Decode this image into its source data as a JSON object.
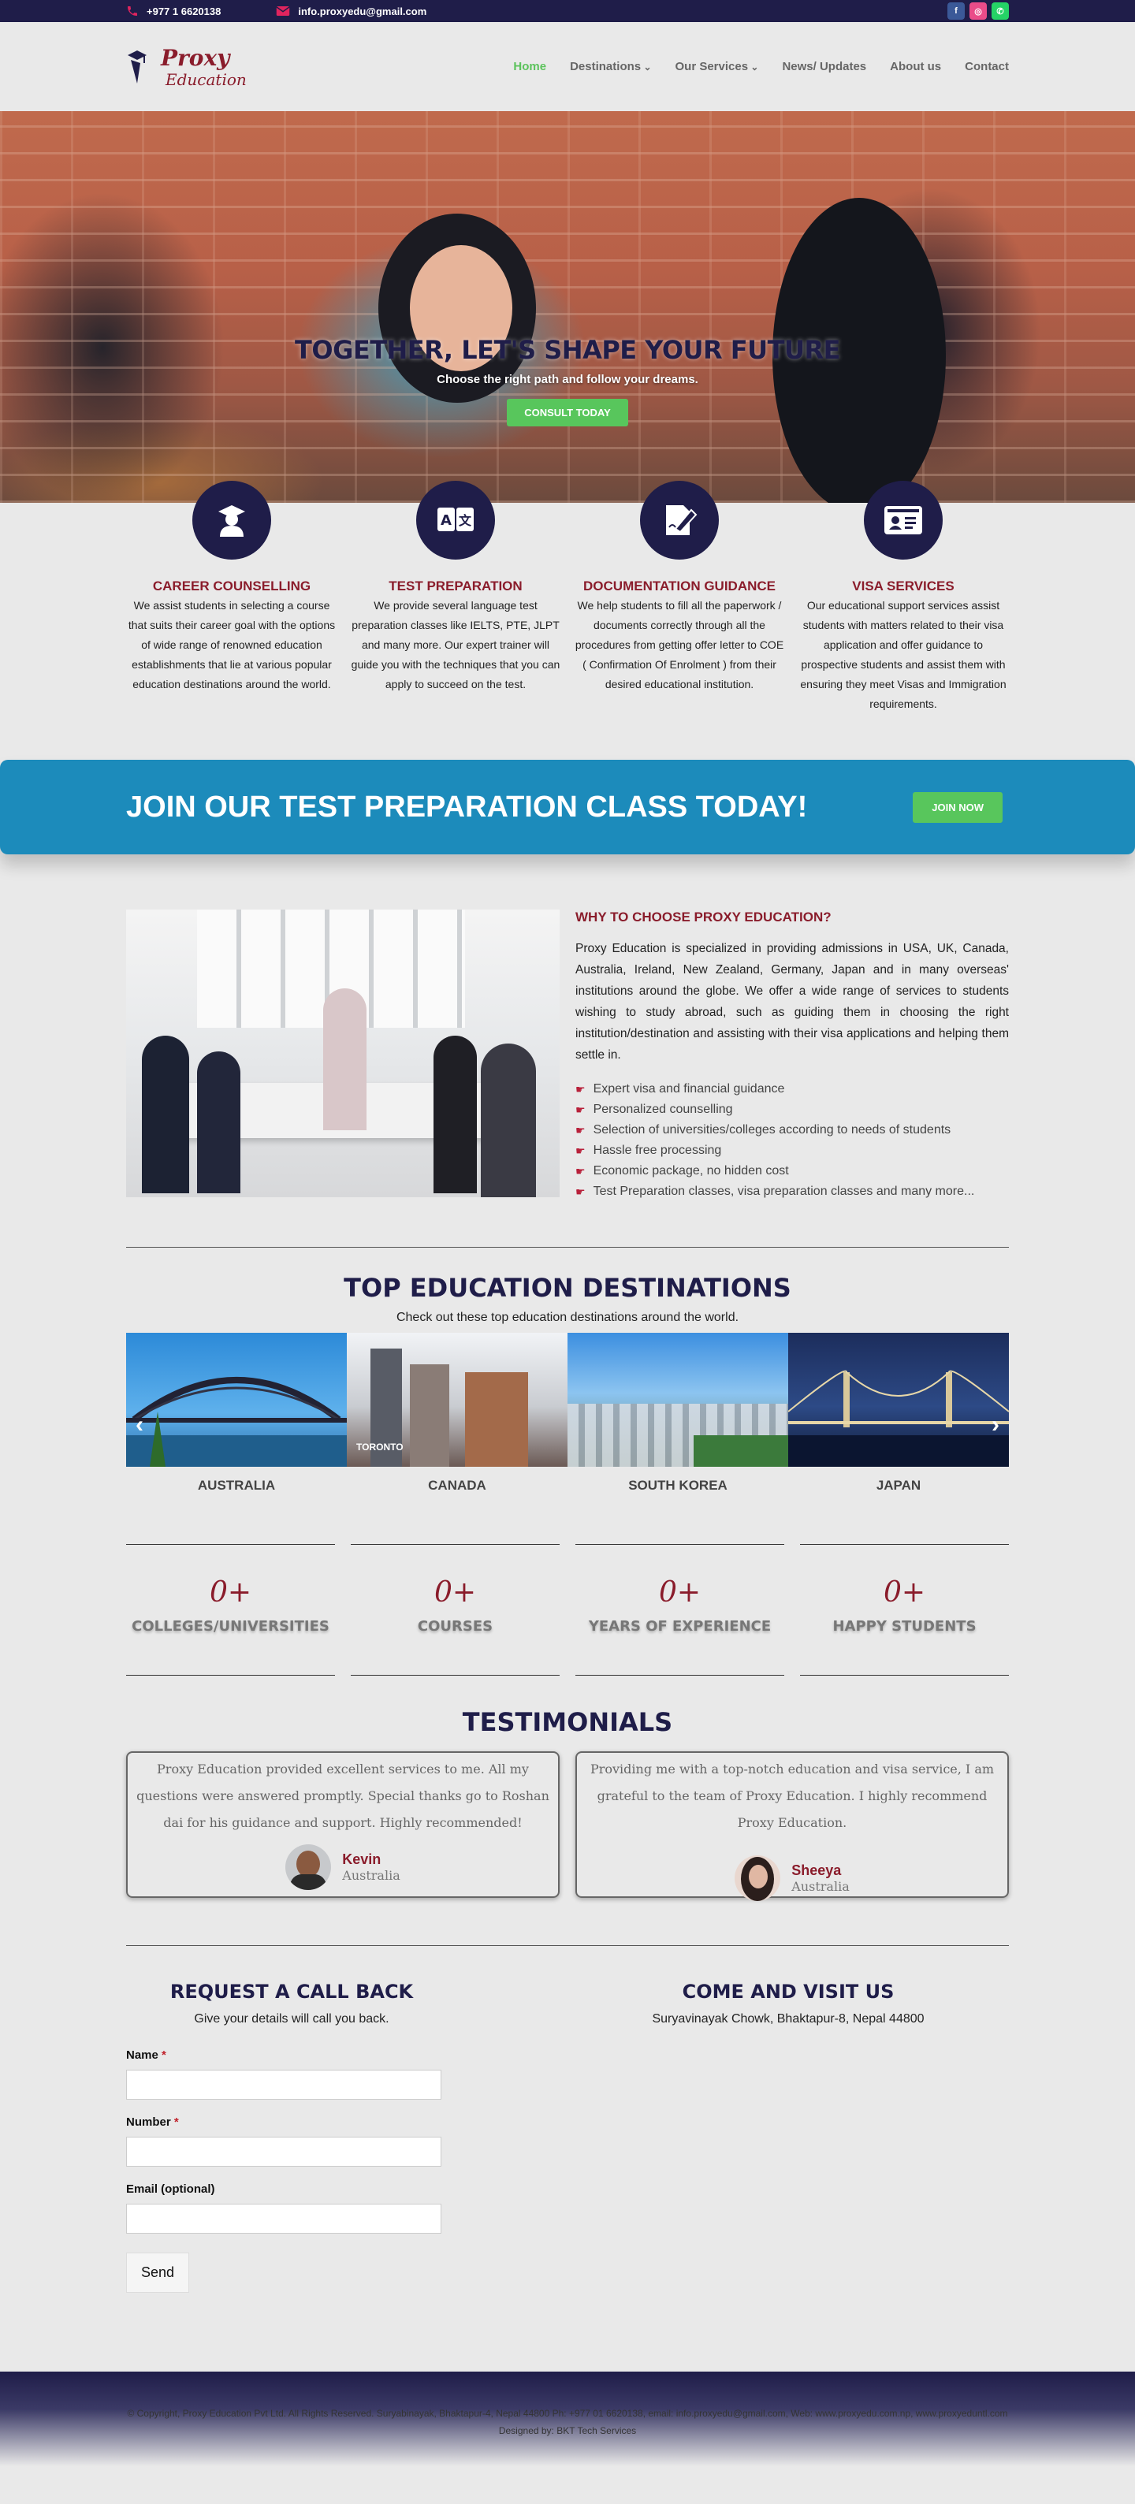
{
  "topbar": {
    "phone": "+977 1 6620138",
    "email": "info.proxyedu@gmail.com",
    "socials": [
      {
        "name": "facebook",
        "color": "#3b5998",
        "glyph": "f"
      },
      {
        "name": "instagram",
        "color": "#ea4c89",
        "glyph": "◎"
      },
      {
        "name": "whatsapp",
        "color": "#25d366",
        "glyph": "✆"
      }
    ]
  },
  "header": {
    "logo_line1": "Proxy",
    "logo_line2": "Education",
    "nav": [
      {
        "label": "Home",
        "active": true
      },
      {
        "label": "Destinations",
        "dropdown": true
      },
      {
        "label": "Our Services",
        "dropdown": true
      },
      {
        "label": "News/ Updates"
      },
      {
        "label": "About us"
      },
      {
        "label": "Contact"
      }
    ]
  },
  "hero": {
    "title": "TOGETHER, LET'S SHAPE YOUR FUTURE",
    "subtitle": "Choose the right path and follow your dreams.",
    "cta": "CONSULT TODAY"
  },
  "services": [
    {
      "icon": "graduate-icon",
      "title": "CAREER COUNSELLING",
      "text": "We assist students in selecting a course that suits their career goal with the options of wide range of renowned education establishments that lie at various popular education destinations around the world."
    },
    {
      "icon": "translate-icon",
      "title": "TEST PREPARATION",
      "text": "We provide several language test preparation classes like IELTS, PTE, JLPT and many more. Our expert trainer will guide you with the techniques that you can apply to succeed on the test."
    },
    {
      "icon": "document-sign-icon",
      "title": "DOCUMENTATION GUIDANCE",
      "text": "We help students to fill all the paperwork / documents correctly through all the procedures from getting offer letter to COE ( Confirmation Of Enrolment ) from their desired educational institution."
    },
    {
      "icon": "id-card-icon",
      "title": "VISA SERVICES",
      "text": "Our educational support services assist students with matters related to their visa application and offer guidance to prospective students and assist them with ensuring they meet Visas and Immigration requirements."
    }
  ],
  "join": {
    "title": "JOIN OUR TEST PREPARATION CLASS TODAY!",
    "button": "JOIN NOW"
  },
  "why": {
    "title": "WHY TO CHOOSE PROXY EDUCATION?",
    "text": "Proxy Education is specialized in providing admissions in USA, UK, Canada, Australia, Ireland, New Zealand, Germany, Japan and in many overseas' institutions around the globe. We offer a wide range of services to students wishing to study abroad, such as guiding them in choosing the right institution/destination and assisting with their visa applications and helping them settle in.",
    "points": [
      "Expert visa and financial guidance",
      "Personalized counselling",
      "Selection of universities/colleges according to needs of students",
      "Hassle free processing",
      "Economic package, no hidden cost",
      "Test Preparation classes, visa preparation classes and many more..."
    ]
  },
  "destinations": {
    "title": "TOP EDUCATION DESTINATIONS",
    "subtitle": "Check out these top education destinations around the world.",
    "items": [
      {
        "name": "AUSTRALIA"
      },
      {
        "name": "CANADA",
        "sign": "TORONTO"
      },
      {
        "name": "SOUTH KOREA"
      },
      {
        "name": "JAPAN"
      }
    ]
  },
  "counters": [
    {
      "number": "0+",
      "label": "COLLEGES/UNIVERSITIES"
    },
    {
      "number": "0+",
      "label": "COURSES"
    },
    {
      "number": "0+",
      "label": "YEARS OF EXPERIENCE"
    },
    {
      "number": "0+",
      "label": "HAPPY STUDENTS"
    }
  ],
  "testimonials": {
    "title": "TESTIMONIALS",
    "items": [
      {
        "quote": "Proxy Education provided excellent services to me. All my questions were answered promptly. Special thanks go to Roshan dai for his guidance and support. Highly recommended!",
        "name": "Kevin",
        "location": "Australia"
      },
      {
        "quote": "Providing me with a top-notch education and visa service, I am grateful to the team of Proxy Education. I highly recommend Proxy Education.",
        "name": "Sheeya",
        "location": "Australia"
      }
    ]
  },
  "contact": {
    "callback_title": "REQUEST A CALL BACK",
    "callback_sub": "Give your details will call you back.",
    "visit_title": "COME AND VISIT US",
    "visit_address": "Suryavinayak Chowk, Bhaktapur-8, Nepal 44800",
    "form": {
      "name_label": "Name",
      "number_label": "Number",
      "email_label": "Email (optional)",
      "required_mark": "*",
      "send": "Send"
    }
  },
  "footer": {
    "copyright": "© Copyright, Proxy Education Pvt Ltd. All Rights Reserved. Suryabinayak, Bhaktapur-4, Nepal 44800 Ph: +977 01 6620138, email: info.proxyedu@gmail.com, Web: www.proxyedu.com.np, www.proxyeduntl.com",
    "designed": "Designed by: BKT Tech Services"
  }
}
